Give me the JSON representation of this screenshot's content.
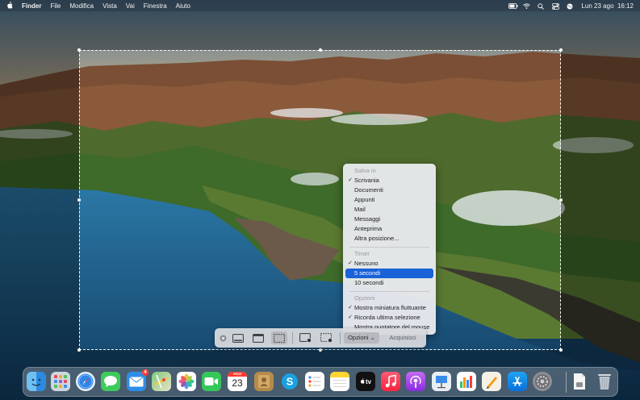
{
  "menubar": {
    "apple_icon": "apple-logo-icon",
    "items": [
      "Finder",
      "File",
      "Modifica",
      "Vista",
      "Vai",
      "Finestra",
      "Aiuto"
    ],
    "status_icons": [
      "battery-icon",
      "wifi-icon",
      "search-icon",
      "control-center-icon",
      "siri-icon"
    ],
    "clock": "Lun 23 ago  16:12"
  },
  "options_menu": {
    "save_to": {
      "header": "Salva in",
      "items": [
        {
          "label": "Scrivania",
          "checked": true
        },
        {
          "label": "Documenti",
          "checked": false
        },
        {
          "label": "Appunti",
          "checked": false
        },
        {
          "label": "Mail",
          "checked": false
        },
        {
          "label": "Messaggi",
          "checked": false
        },
        {
          "label": "Anteprima",
          "checked": false
        },
        {
          "label": "Altra posizione...",
          "checked": false
        }
      ]
    },
    "timer": {
      "header": "Timer",
      "items": [
        {
          "label": "Nessuno",
          "checked": true
        },
        {
          "label": "5 secondi",
          "checked": false,
          "highlighted": true
        },
        {
          "label": "10 secondi",
          "checked": false
        }
      ]
    },
    "options": {
      "header": "Opzioni",
      "items": [
        {
          "label": "Mostra miniatura fluttuante",
          "checked": true
        },
        {
          "label": "Ricorda ultima selezione",
          "checked": true
        },
        {
          "label": "Mostra puntatore del mouse",
          "checked": false
        }
      ]
    },
    "check_glyph": "✓"
  },
  "toolbar": {
    "close_icon": "close-icon",
    "buttons": [
      "capture-entire-screen-icon",
      "capture-window-icon",
      "capture-selection-icon",
      "record-screen-icon",
      "record-selection-icon"
    ],
    "options_label": "Opzioni ⌄",
    "capture_label": "Acquisisci"
  },
  "dock": {
    "apps": [
      "Finder",
      "Launchpad",
      "Safari",
      "Messaggi",
      "Mail",
      "Mappe",
      "Foto",
      "FaceTime",
      "Calendario",
      "Contatti",
      "Skype",
      "Promemoria",
      "Note",
      "Apple TV",
      "Musica",
      "Podcast",
      "Keynote",
      "Numbers",
      "Pages",
      "App Store",
      "Preferenze di Sistema",
      "Documenti",
      "Cestino"
    ],
    "mail_badge": "4",
    "calendar": {
      "month": "AGO",
      "day": "23"
    },
    "tv_label": "tv"
  },
  "colors": {
    "selection_highlight": "#1962d8",
    "badge": "#ff3b30"
  }
}
